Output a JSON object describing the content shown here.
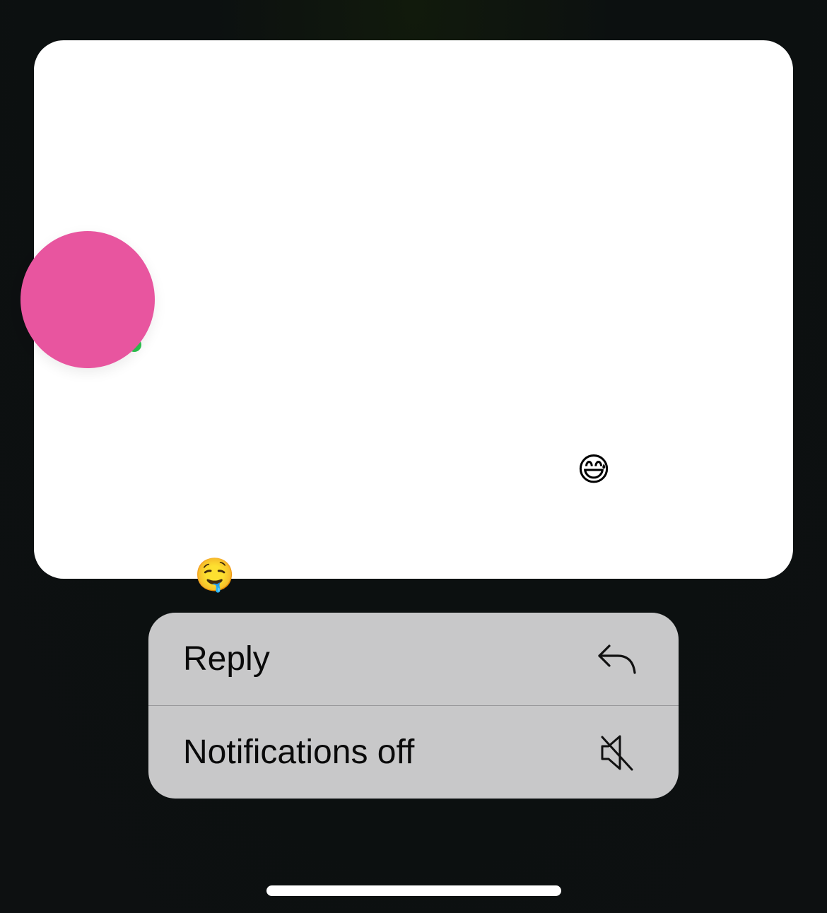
{
  "preview": {
    "avatar_color": "#e8559f",
    "online_status_color": "#2cc44f",
    "emojis": {
      "sweat": "😅",
      "drool": "🤤"
    }
  },
  "menu": {
    "items": [
      {
        "label": "Reply",
        "icon": "reply-arrow-icon"
      },
      {
        "label": "Notifications off",
        "icon": "speaker-muted-icon"
      }
    ]
  },
  "colors": {
    "menu_background": "#c8c8c9",
    "card_background": "#ffffff",
    "screen_background": "#0d1011"
  }
}
